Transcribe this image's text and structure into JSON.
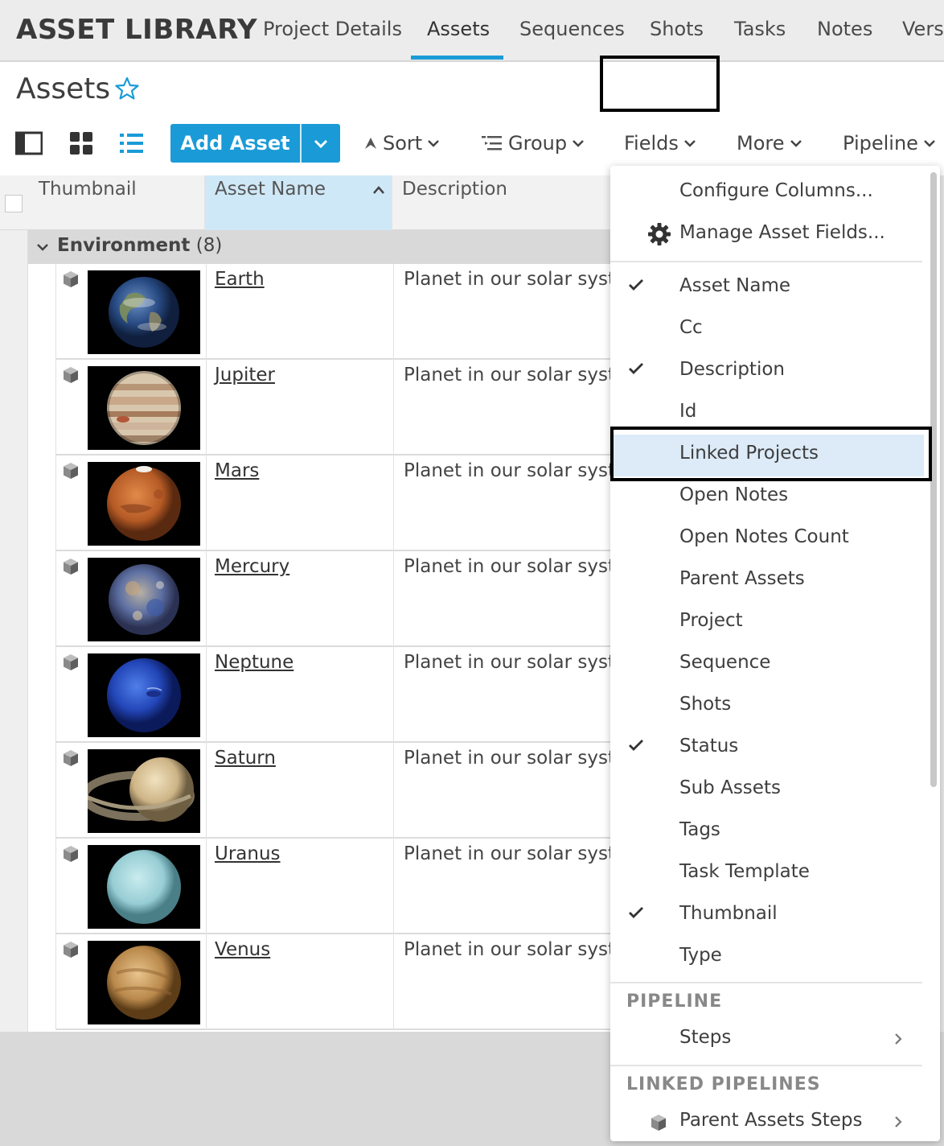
{
  "app": {
    "title": "ASSET LIBRARY"
  },
  "nav": {
    "tabs": [
      "Project Details",
      "Assets",
      "Sequences",
      "Shots",
      "Tasks",
      "Notes",
      "Vers"
    ]
  },
  "page": {
    "title": "Assets"
  },
  "toolbar": {
    "add_asset": "Add Asset",
    "sort": "Sort",
    "group": "Group",
    "fields": "Fields",
    "more": "More",
    "pipeline": "Pipeline"
  },
  "table": {
    "headers": [
      "Thumbnail",
      "Asset Name",
      "Description"
    ],
    "group": {
      "name": "Environment",
      "count": "(8)"
    },
    "rows": [
      {
        "name": "Earth",
        "description": "Planet in our solar syst"
      },
      {
        "name": "Jupiter",
        "description": "Planet in our solar syst"
      },
      {
        "name": "Mars",
        "description": "Planet in our solar syst"
      },
      {
        "name": "Mercury",
        "description": "Planet in our solar syst"
      },
      {
        "name": "Neptune",
        "description": "Planet in our solar syst"
      },
      {
        "name": "Saturn",
        "description": "Planet in our solar syst"
      },
      {
        "name": "Uranus",
        "description": "Planet in our solar syst"
      },
      {
        "name": "Venus",
        "description": "Planet in our solar syst"
      }
    ]
  },
  "menu": {
    "configure": "Configure Columns...",
    "manage": "Manage Asset Fields...",
    "fields": [
      {
        "label": "Asset Name",
        "checked": true
      },
      {
        "label": "Cc",
        "checked": false
      },
      {
        "label": "Description",
        "checked": true
      },
      {
        "label": "Id",
        "checked": false
      },
      {
        "label": "Linked Projects",
        "checked": false,
        "highlighted": true
      },
      {
        "label": "Open Notes",
        "checked": false
      },
      {
        "label": "Open Notes Count",
        "checked": false
      },
      {
        "label": "Parent Assets",
        "checked": false
      },
      {
        "label": "Project",
        "checked": false
      },
      {
        "label": "Sequence",
        "checked": false
      },
      {
        "label": "Shots",
        "checked": false
      },
      {
        "label": "Status",
        "checked": true
      },
      {
        "label": "Sub Assets",
        "checked": false
      },
      {
        "label": "Tags",
        "checked": false
      },
      {
        "label": "Task Template",
        "checked": false
      },
      {
        "label": "Thumbnail",
        "checked": true
      },
      {
        "label": "Type",
        "checked": false
      }
    ],
    "pipeline_section": "PIPELINE",
    "steps": "Steps",
    "linked_section": "LINKED PIPELINES",
    "parent_steps": "Parent Assets Steps"
  },
  "colors": {
    "accent": "#1a9bd7",
    "highlight": "#dcebf7",
    "sorted_header": "#cfe8f7"
  }
}
